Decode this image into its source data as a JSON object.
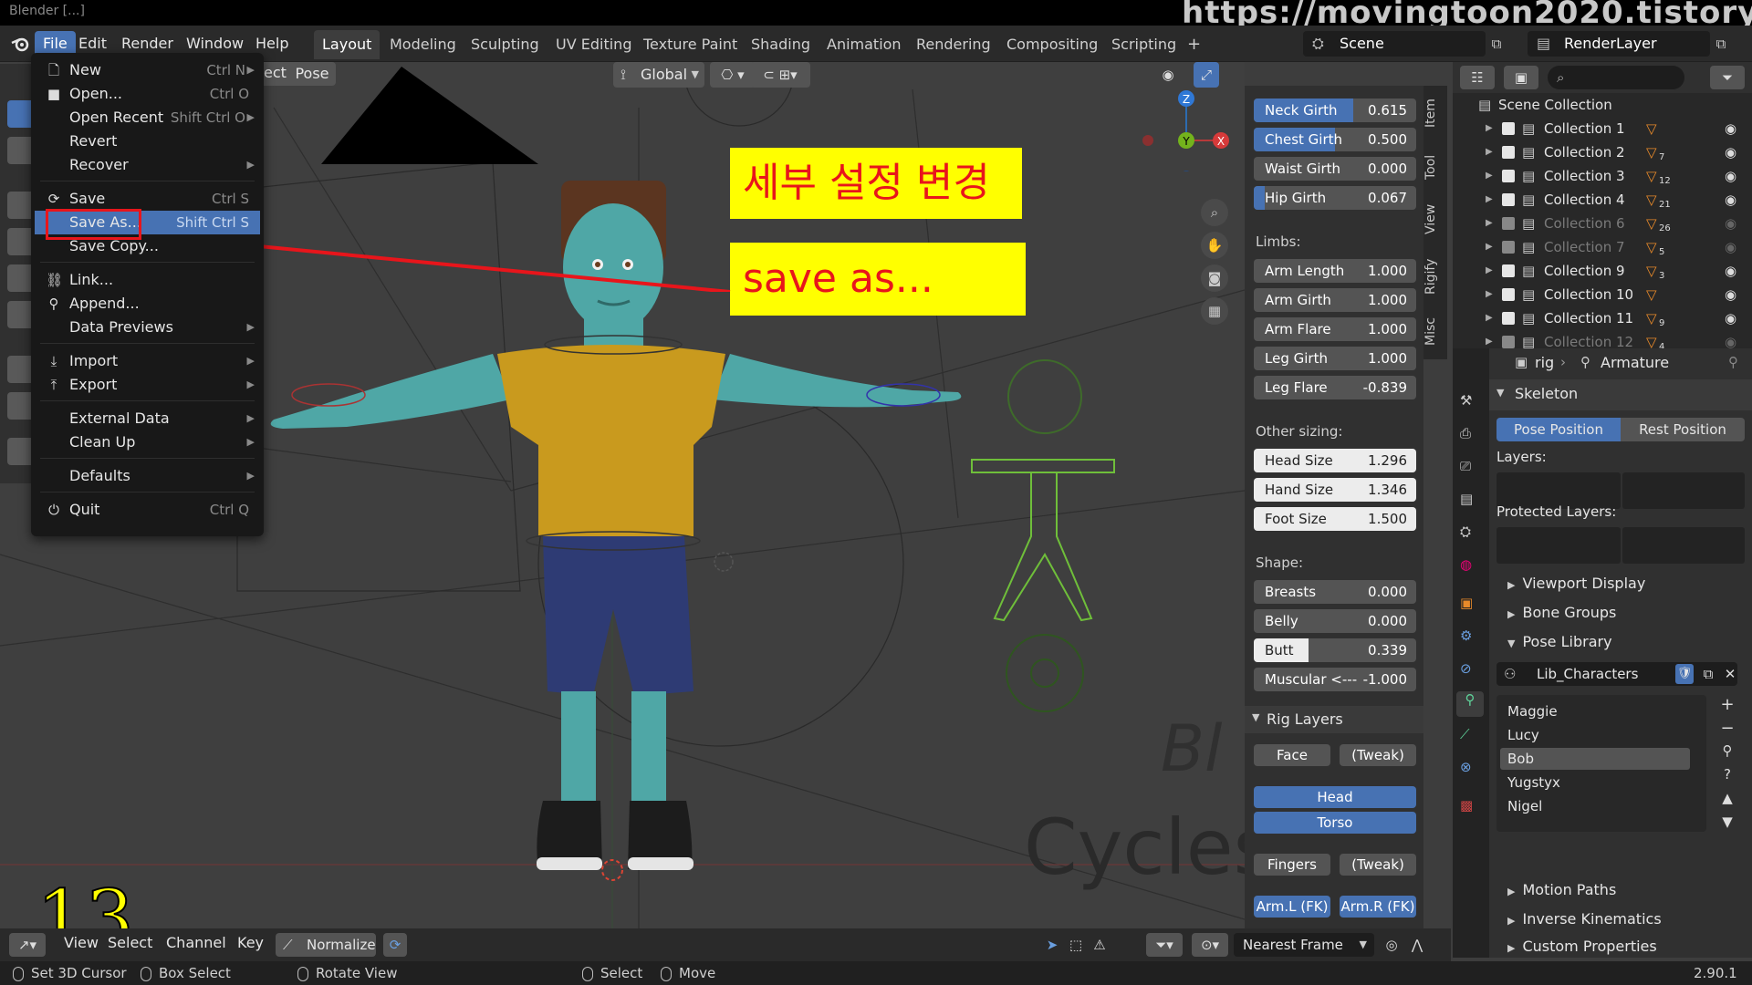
{
  "window": {
    "title_fragment": "Blender [...] ",
    "watermark": "https://movingtoon2020.tistory.com"
  },
  "topbar": {
    "menus": [
      "File",
      "Edit",
      "Render",
      "Window",
      "Help"
    ],
    "workspaces": [
      "Layout",
      "Modeling",
      "Sculpting",
      "UV Editing",
      "Texture Paint",
      "Shading",
      "Animation",
      "Rendering",
      "Compositing",
      "Scripting"
    ],
    "add_tab": "+",
    "scene": "Scene",
    "view_layer": "RenderLayer"
  },
  "viewport_header": {
    "mode_partial": "ect",
    "pose_menu": "Pose",
    "orientation": "Global",
    "nav_labels": {
      "z": "Z",
      "y": "Y",
      "x": "X"
    }
  },
  "file_menu": {
    "items": [
      {
        "label": "New",
        "shortcut": "Ctrl N",
        "submenu": true,
        "icon": "new-file-icon"
      },
      {
        "label": "Open...",
        "shortcut": "Ctrl O",
        "submenu": false,
        "icon": "folder-icon"
      },
      {
        "label": "Open Recent",
        "shortcut": "Shift Ctrl O",
        "submenu": true,
        "icon": ""
      },
      {
        "label": "Revert",
        "shortcut": "",
        "submenu": false,
        "icon": ""
      },
      {
        "label": "Recover",
        "shortcut": "",
        "submenu": true,
        "icon": ""
      },
      {
        "label": "Save",
        "shortcut": "Ctrl S",
        "submenu": false,
        "icon": "save-icon"
      },
      {
        "label": "Save As...",
        "shortcut": "Shift Ctrl S",
        "submenu": false,
        "icon": "",
        "selected": true
      },
      {
        "label": "Save Copy...",
        "shortcut": "",
        "submenu": false,
        "icon": ""
      },
      {
        "label": "Link...",
        "shortcut": "",
        "submenu": false,
        "icon": "link-icon"
      },
      {
        "label": "Append...",
        "shortcut": "",
        "submenu": false,
        "icon": "append-icon"
      },
      {
        "label": "Data Previews",
        "shortcut": "",
        "submenu": true,
        "icon": ""
      },
      {
        "label": "Import",
        "shortcut": "",
        "submenu": true,
        "icon": "import-icon"
      },
      {
        "label": "Export",
        "shortcut": "",
        "submenu": true,
        "icon": "export-icon"
      },
      {
        "label": "External Data",
        "shortcut": "",
        "submenu": true,
        "icon": ""
      },
      {
        "label": "Clean Up",
        "shortcut": "",
        "submenu": true,
        "icon": ""
      },
      {
        "label": "Defaults",
        "shortcut": "",
        "submenu": true,
        "icon": ""
      },
      {
        "label": "Quit",
        "shortcut": "Ctrl Q",
        "submenu": false,
        "icon": "power-icon"
      }
    ]
  },
  "annotations": {
    "title_ko": "세부 설정 변경",
    "save_as": "save as...",
    "step_number": "13"
  },
  "viewport_overlay_text": {
    "engine_partial": "Bl",
    "engine": "Cycles"
  },
  "npanel": {
    "tabs": [
      "Item",
      "Tool",
      "View",
      "Rigify",
      "Misc"
    ],
    "girths": [
      {
        "label": "Neck Girth",
        "value": "0.615",
        "fraction": 0.615
      },
      {
        "label": "Chest Girth",
        "value": "0.500",
        "fraction": 0.5
      },
      {
        "label": "Waist Girth",
        "value": "0.000",
        "fraction": 0.0
      },
      {
        "label": "Hip Girth",
        "value": "0.067",
        "fraction": 0.067
      }
    ],
    "limbs_heading": "Limbs:",
    "limbs": [
      {
        "label": "Arm Length",
        "value": "1.000",
        "fraction": 1.0
      },
      {
        "label": "Arm Girth",
        "value": "1.000",
        "fraction": 1.0
      },
      {
        "label": "Arm Flare",
        "value": "1.000",
        "fraction": 1.0
      },
      {
        "label": "Leg Girth",
        "value": "1.000",
        "fraction": 1.0
      },
      {
        "label": "Leg Flare",
        "value": "-0.839",
        "fraction": 0.0
      }
    ],
    "sizing_heading": "Other sizing:",
    "sizing": [
      {
        "label": "Head Size",
        "value": "1.296",
        "fraction": 1.0
      },
      {
        "label": "Hand Size",
        "value": "1.346",
        "fraction": 1.0
      },
      {
        "label": "Foot Size",
        "value": "1.500",
        "fraction": 1.0
      }
    ],
    "shape_heading": "Shape:",
    "shape": [
      {
        "label": "Breasts",
        "value": "0.000",
        "fraction": 0.0
      },
      {
        "label": "Belly",
        "value": "0.000",
        "fraction": 0.0
      },
      {
        "label": "Butt",
        "value": "0.339",
        "fraction": 0.339
      },
      {
        "label": "Muscular <---",
        "value": "-1.000",
        "fraction": 0.0
      }
    ],
    "rig_layers_heading": "Rig Layers",
    "rig_layers": {
      "face": "Face",
      "tweak1": "(Tweak)",
      "head": "Head",
      "torso": "Torso",
      "fingers": "Fingers",
      "tweak2": "(Tweak)",
      "arm_l": "Arm.L (FK)",
      "arm_r": "Arm.R (FK)"
    }
  },
  "outliner": {
    "root": "Scene Collection",
    "collections": [
      {
        "name": "Collection 1",
        "dim": false,
        "badge": ""
      },
      {
        "name": "Collection 2",
        "dim": false,
        "badge": "7"
      },
      {
        "name": "Collection 3",
        "dim": false,
        "badge": "12"
      },
      {
        "name": "Collection 4",
        "dim": false,
        "badge": "21"
      },
      {
        "name": "Collection 6",
        "dim": true,
        "badge": "26"
      },
      {
        "name": "Collection 7",
        "dim": true,
        "badge": "5"
      },
      {
        "name": "Collection 9",
        "dim": false,
        "badge": "3"
      },
      {
        "name": "Collection 10",
        "dim": false,
        "badge": ""
      },
      {
        "name": "Collection 11",
        "dim": false,
        "badge": "9"
      },
      {
        "name": "Collection 12",
        "dim": true,
        "badge": "4"
      }
    ]
  },
  "properties": {
    "breadcrumb_object": "rig",
    "breadcrumb_data": "Armature",
    "skeleton_heading": "Skeleton",
    "pose_position": "Pose Position",
    "rest_position": "Rest Position",
    "layers_label": "Layers:",
    "protected_layers_label": "Protected Layers:",
    "sections": [
      "Viewport Display",
      "Bone Groups",
      "Pose Library"
    ],
    "library_name": "Lib_Characters",
    "poses": [
      "Maggie",
      "Lucy",
      "Bob",
      "Yugstyx",
      "Nigel"
    ],
    "selected_pose": "Bob",
    "bottom_sections": [
      "Motion Paths",
      "Inverse Kinematics",
      "Custom Properties"
    ]
  },
  "timeline": {
    "menus": [
      "View",
      "Select",
      "Channel",
      "Key"
    ],
    "normalize": "Normalize",
    "snap": "Nearest Frame"
  },
  "statusbar": {
    "items": [
      "Set 3D Cursor",
      "Box Select",
      "Rotate View",
      "Select",
      "Move"
    ],
    "version": "2.90.1"
  },
  "colors": {
    "accent": "#4772b3",
    "annotation_yellow": "#ffff00",
    "annotation_red": "#e8151b",
    "character_skin": "#4fa7a6",
    "shirt": "#c99a1e",
    "shorts": "#2e3b74",
    "rig_green": "#6fbf3a"
  }
}
